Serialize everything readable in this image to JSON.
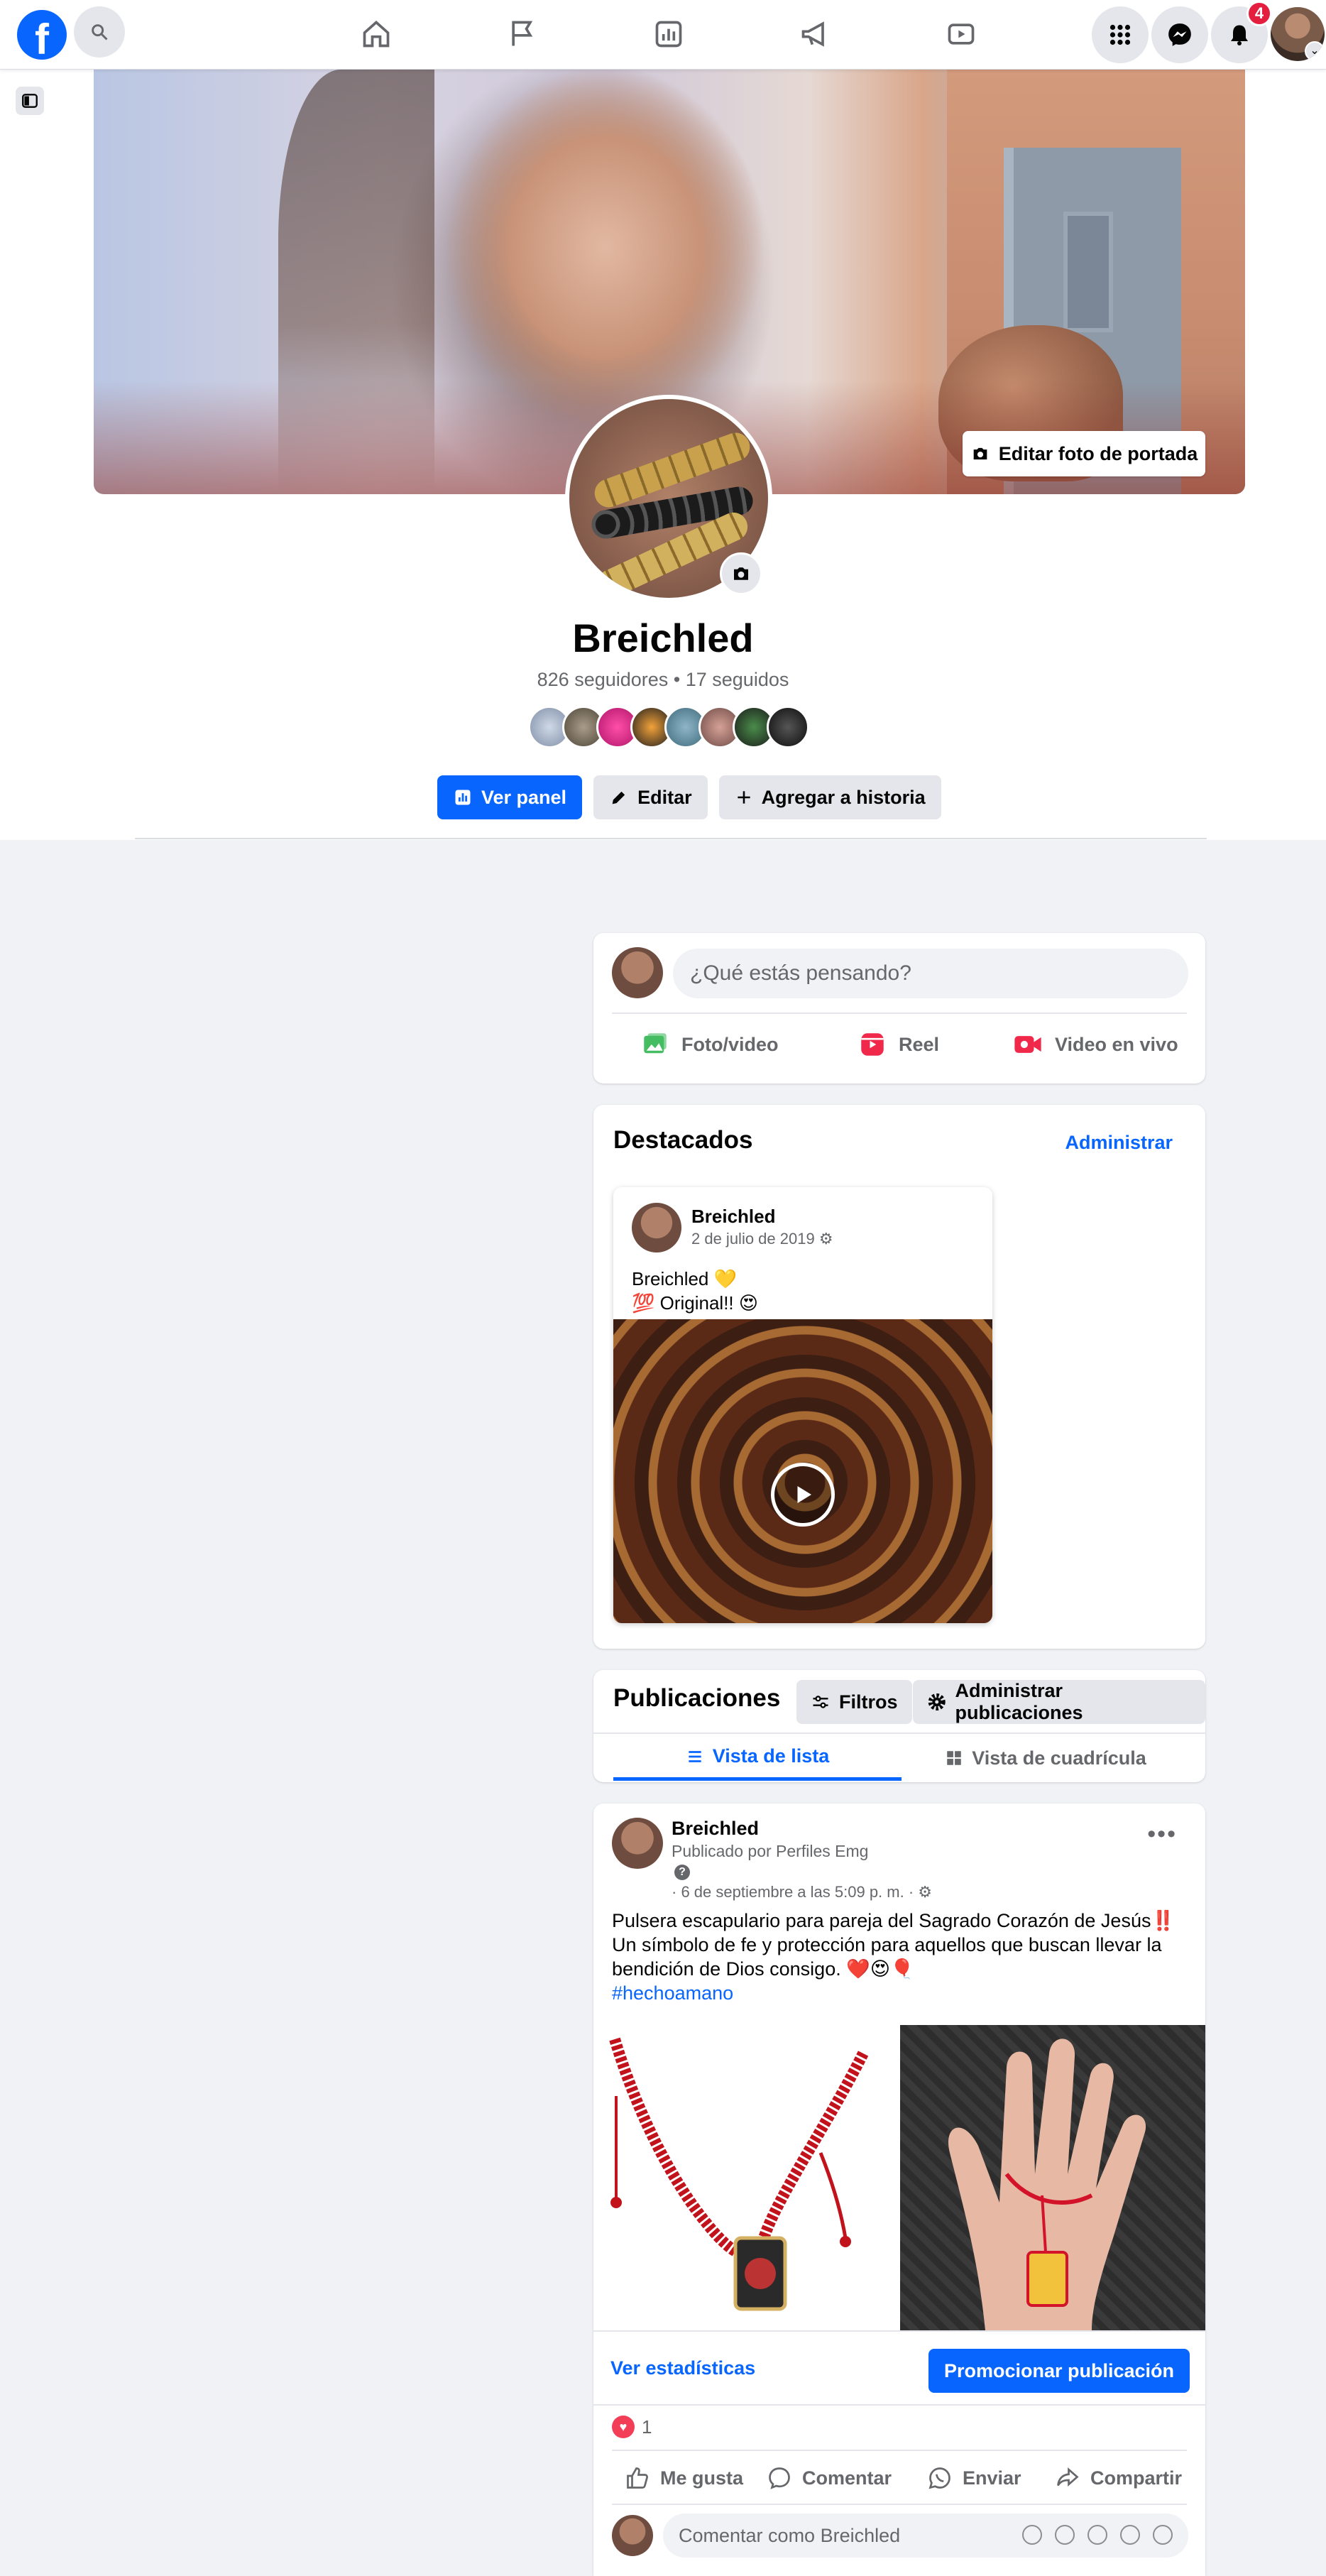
{
  "nav": {
    "logo_letter": "f",
    "notification_count": "4"
  },
  "profile": {
    "cover_button": "Editar foto de portada",
    "name": "Breichled",
    "stats": "826 seguidores • 17 seguidos",
    "actions": {
      "dashboard": "Ver panel",
      "edit": "Editar",
      "add_story": "Agregar a historia"
    }
  },
  "composer": {
    "placeholder": "¿Qué estás pensando?",
    "photo_video": "Foto/video",
    "reel": "Reel",
    "live_video": "Video en vivo"
  },
  "featured": {
    "title": "Destacados",
    "manage": "Administrar",
    "item": {
      "author": "Breichled",
      "date": "2 de julio de 2019",
      "line1": "Breichled 💛",
      "line2": "💯 Original!! 😍"
    }
  },
  "posts_section": {
    "title": "Publicaciones",
    "filters": "Filtros",
    "manage_posts": "Administrar publicaciones",
    "list_view": "Vista de lista",
    "grid_view": "Vista de cuadrícula"
  },
  "post": {
    "author": "Breichled",
    "published_by": "Publicado por Perfiles Emg",
    "help_glyph": "?",
    "meta": "· 6 de septiembre a las 5:09 p. m. ·",
    "text_line1": "Pulsera escapulario para pareja del Sagrado Corazón de Jesús‼️",
    "text_line2": "Un símbolo de fe y protección para aquellos que buscan llevar la bendición de Dios consigo. ❤️😍🎈",
    "hashtag": "#hechoamano",
    "view_stats": "Ver estadísticas",
    "promote": "Promocionar publicación",
    "reaction_count": "1",
    "like": "Me gusta",
    "comment": "Comentar",
    "send": "Enviar",
    "share": "Compartir",
    "comment_placeholder": "Comentar como Breichled"
  }
}
